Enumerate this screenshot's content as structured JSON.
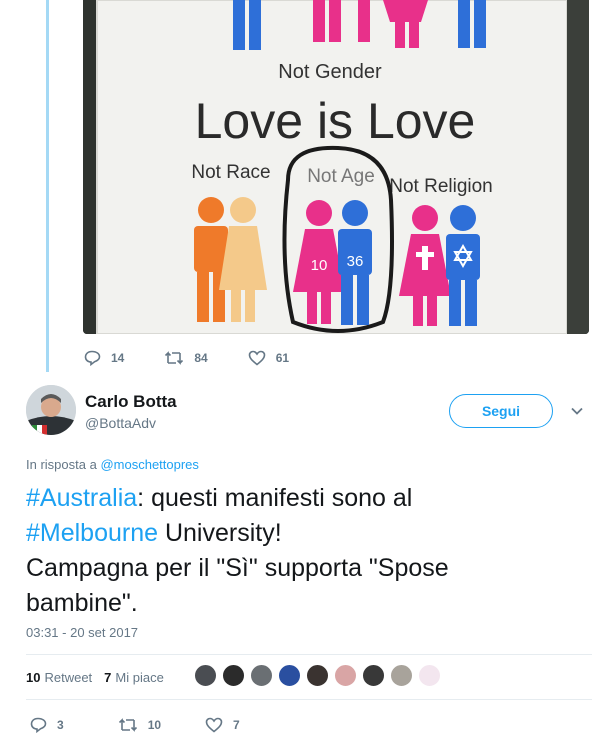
{
  "photo": {
    "texts": {
      "not_gender": "Not Gender",
      "love_is_love": "Love is Love",
      "not_race": "Not Race",
      "not_age": "Not Age",
      "not_religion": "Not Religion",
      "age_left": "10",
      "age_right": "36"
    }
  },
  "previous_tweet": {
    "replies": "14",
    "retweets": "84",
    "likes": "61"
  },
  "tweet": {
    "author_name": "Carlo Botta",
    "author_handle": "@BottaAdv",
    "follow_label": "Segui",
    "reply_prefix": "In risposta a",
    "reply_handle": "@moschettopres",
    "text": {
      "hashtag1": "#Australia",
      "part1": ": questi manifesti sono al",
      "hashtag2": "#Melbourne",
      "part2": " University!",
      "line3": "Campagna per il \"Sì\" supporta \"Spose",
      "line4": "bambine\"."
    },
    "timestamp": "03:31 - 20 set 2017",
    "retweet_count": "10",
    "retweet_label": "Retweet",
    "like_count": "7",
    "like_label": "Mi piace",
    "footer": {
      "replies": "3",
      "retweets": "10",
      "likes": "7"
    }
  },
  "colors": {
    "accent": "#1da1f2",
    "muted": "#657786",
    "thread_line": "#a4d9f5",
    "pink": "#e8308a",
    "blue": "#2e6fd8",
    "orange": "#ef7a2a",
    "peach": "#f4c98a"
  }
}
